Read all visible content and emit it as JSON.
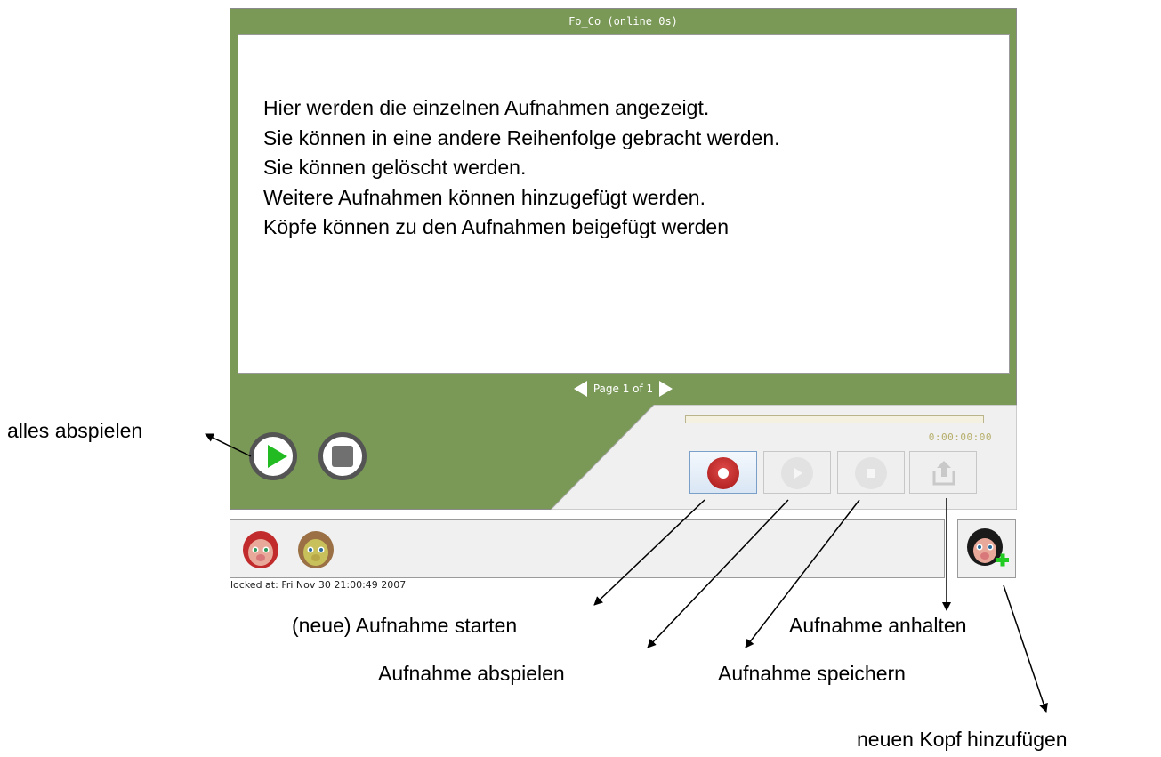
{
  "window": {
    "title": "Fo_Co (online 0s)"
  },
  "content": {
    "lines": [
      "Hier werden die einzelnen Aufnahmen angezeigt.",
      "Sie können in eine andere Reihenfolge gebracht werden.",
      "Sie können gelöscht werden.",
      "Weitere Aufnahmen können hinzugefügt werden.",
      "Köpfe können zu den Aufnahmen beigefügt werden"
    ]
  },
  "pager": {
    "label": "Page 1 of 1"
  },
  "player": {
    "play_all_icon": "play-icon",
    "stop_all_icon": "stop-icon"
  },
  "recorder": {
    "timer": "0:00:00:00",
    "progress_fraction": 0,
    "buttons": [
      {
        "icon": "record-icon",
        "state": "active"
      },
      {
        "icon": "play-icon",
        "state": "disabled"
      },
      {
        "icon": "stop-icon",
        "state": "disabled"
      },
      {
        "icon": "upload-icon",
        "state": "disabled"
      }
    ]
  },
  "heads": {
    "items": [
      {
        "icon": "red-hair-head-icon"
      },
      {
        "icon": "brown-hair-head-icon"
      }
    ],
    "add_icon": "add-head-icon",
    "locked_text": "locked at: Fri Nov 30 21:00:49 2007"
  },
  "annotations": {
    "play_all": "alles abspielen",
    "record_start": "(neue) Aufnahme starten",
    "play_recording": "Aufnahme abspielen",
    "save_recording": "Aufnahme speichern",
    "stop_recording": "Aufnahme anhalten",
    "add_head": "neuen Kopf hinzufügen"
  },
  "colors": {
    "panel_green": "#7a9956",
    "recorder_gray": "#f0f0f0",
    "record_red": "#c22020",
    "play_green": "#22bb22"
  }
}
